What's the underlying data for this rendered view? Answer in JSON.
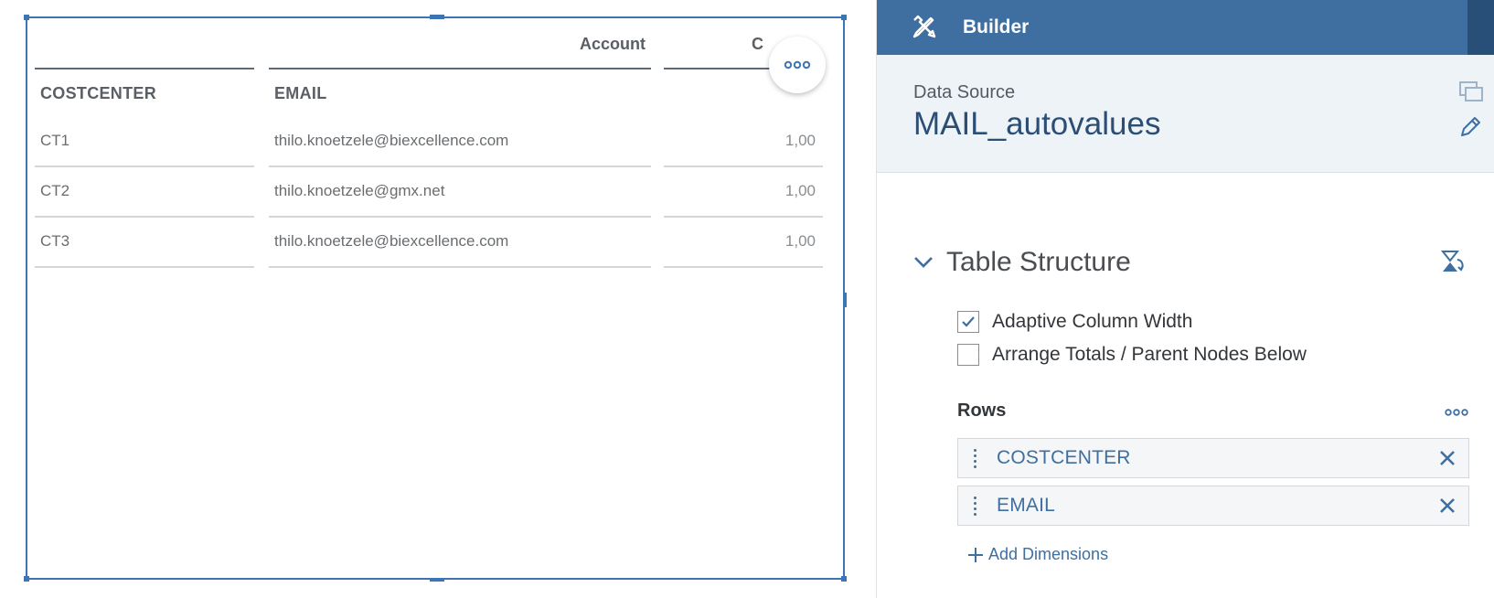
{
  "table": {
    "header_account": "Account",
    "header_col3_partial": "C",
    "columns": [
      "COSTCENTER",
      "EMAIL"
    ],
    "rows": [
      {
        "costcenter": "CT1",
        "email": "thilo.knoetzele@biexcellence.com",
        "value": "1,00"
      },
      {
        "costcenter": "CT2",
        "email": "thilo.knoetzele@gmx.net",
        "value": "1,00"
      },
      {
        "costcenter": "CT3",
        "email": "thilo.knoetzele@biexcellence.com",
        "value": "1,00"
      }
    ]
  },
  "builder": {
    "title": "Builder",
    "data_source_label": "Data Source",
    "data_source_value": "MAIL_autovalues",
    "section_title": "Table Structure",
    "options": [
      {
        "label": "Adaptive Column Width",
        "checked": true
      },
      {
        "label": "Arrange Totals / Parent Nodes Below",
        "checked": false
      }
    ],
    "rows_label": "Rows",
    "row_dimensions": [
      "COSTCENTER",
      "EMAIL"
    ],
    "add_dimensions": "Add Dimensions"
  },
  "colors": {
    "accent": "#3f6fa0",
    "selection_border": "#3d74b3",
    "header_bar": "#3f6fa0",
    "panel_bg": "#eef3f8"
  },
  "icons": {
    "builder": "tools-icon",
    "copy": "copy-icon",
    "edit": "pencil-icon",
    "collapse": "chevron-down-icon",
    "swap": "swap-axes-icon",
    "more": "more-icon",
    "remove": "close-icon",
    "add": "plus-icon"
  }
}
